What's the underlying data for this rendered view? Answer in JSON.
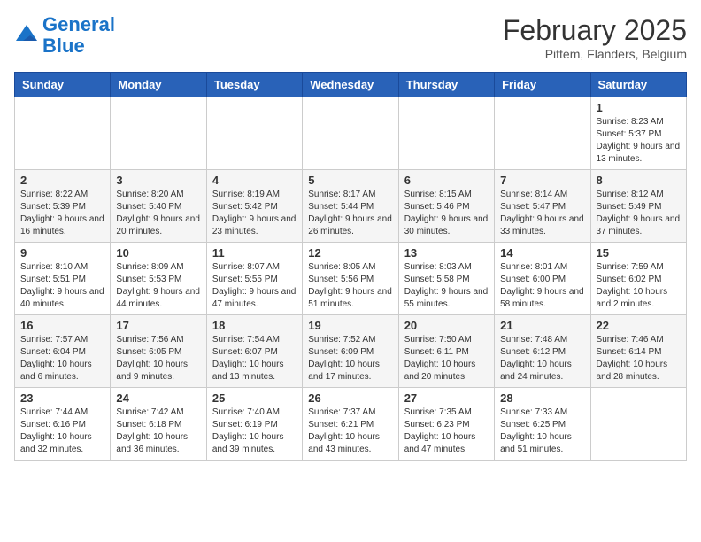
{
  "header": {
    "logo_line1": "General",
    "logo_line2": "Blue",
    "month_title": "February 2025",
    "location": "Pittem, Flanders, Belgium"
  },
  "days_of_week": [
    "Sunday",
    "Monday",
    "Tuesday",
    "Wednesday",
    "Thursday",
    "Friday",
    "Saturday"
  ],
  "weeks": [
    [
      {
        "num": "",
        "info": ""
      },
      {
        "num": "",
        "info": ""
      },
      {
        "num": "",
        "info": ""
      },
      {
        "num": "",
        "info": ""
      },
      {
        "num": "",
        "info": ""
      },
      {
        "num": "",
        "info": ""
      },
      {
        "num": "1",
        "info": "Sunrise: 8:23 AM\nSunset: 5:37 PM\nDaylight: 9 hours and 13 minutes."
      }
    ],
    [
      {
        "num": "2",
        "info": "Sunrise: 8:22 AM\nSunset: 5:39 PM\nDaylight: 9 hours and 16 minutes."
      },
      {
        "num": "3",
        "info": "Sunrise: 8:20 AM\nSunset: 5:40 PM\nDaylight: 9 hours and 20 minutes."
      },
      {
        "num": "4",
        "info": "Sunrise: 8:19 AM\nSunset: 5:42 PM\nDaylight: 9 hours and 23 minutes."
      },
      {
        "num": "5",
        "info": "Sunrise: 8:17 AM\nSunset: 5:44 PM\nDaylight: 9 hours and 26 minutes."
      },
      {
        "num": "6",
        "info": "Sunrise: 8:15 AM\nSunset: 5:46 PM\nDaylight: 9 hours and 30 minutes."
      },
      {
        "num": "7",
        "info": "Sunrise: 8:14 AM\nSunset: 5:47 PM\nDaylight: 9 hours and 33 minutes."
      },
      {
        "num": "8",
        "info": "Sunrise: 8:12 AM\nSunset: 5:49 PM\nDaylight: 9 hours and 37 minutes."
      }
    ],
    [
      {
        "num": "9",
        "info": "Sunrise: 8:10 AM\nSunset: 5:51 PM\nDaylight: 9 hours and 40 minutes."
      },
      {
        "num": "10",
        "info": "Sunrise: 8:09 AM\nSunset: 5:53 PM\nDaylight: 9 hours and 44 minutes."
      },
      {
        "num": "11",
        "info": "Sunrise: 8:07 AM\nSunset: 5:55 PM\nDaylight: 9 hours and 47 minutes."
      },
      {
        "num": "12",
        "info": "Sunrise: 8:05 AM\nSunset: 5:56 PM\nDaylight: 9 hours and 51 minutes."
      },
      {
        "num": "13",
        "info": "Sunrise: 8:03 AM\nSunset: 5:58 PM\nDaylight: 9 hours and 55 minutes."
      },
      {
        "num": "14",
        "info": "Sunrise: 8:01 AM\nSunset: 6:00 PM\nDaylight: 9 hours and 58 minutes."
      },
      {
        "num": "15",
        "info": "Sunrise: 7:59 AM\nSunset: 6:02 PM\nDaylight: 10 hours and 2 minutes."
      }
    ],
    [
      {
        "num": "16",
        "info": "Sunrise: 7:57 AM\nSunset: 6:04 PM\nDaylight: 10 hours and 6 minutes."
      },
      {
        "num": "17",
        "info": "Sunrise: 7:56 AM\nSunset: 6:05 PM\nDaylight: 10 hours and 9 minutes."
      },
      {
        "num": "18",
        "info": "Sunrise: 7:54 AM\nSunset: 6:07 PM\nDaylight: 10 hours and 13 minutes."
      },
      {
        "num": "19",
        "info": "Sunrise: 7:52 AM\nSunset: 6:09 PM\nDaylight: 10 hours and 17 minutes."
      },
      {
        "num": "20",
        "info": "Sunrise: 7:50 AM\nSunset: 6:11 PM\nDaylight: 10 hours and 20 minutes."
      },
      {
        "num": "21",
        "info": "Sunrise: 7:48 AM\nSunset: 6:12 PM\nDaylight: 10 hours and 24 minutes."
      },
      {
        "num": "22",
        "info": "Sunrise: 7:46 AM\nSunset: 6:14 PM\nDaylight: 10 hours and 28 minutes."
      }
    ],
    [
      {
        "num": "23",
        "info": "Sunrise: 7:44 AM\nSunset: 6:16 PM\nDaylight: 10 hours and 32 minutes."
      },
      {
        "num": "24",
        "info": "Sunrise: 7:42 AM\nSunset: 6:18 PM\nDaylight: 10 hours and 36 minutes."
      },
      {
        "num": "25",
        "info": "Sunrise: 7:40 AM\nSunset: 6:19 PM\nDaylight: 10 hours and 39 minutes."
      },
      {
        "num": "26",
        "info": "Sunrise: 7:37 AM\nSunset: 6:21 PM\nDaylight: 10 hours and 43 minutes."
      },
      {
        "num": "27",
        "info": "Sunrise: 7:35 AM\nSunset: 6:23 PM\nDaylight: 10 hours and 47 minutes."
      },
      {
        "num": "28",
        "info": "Sunrise: 7:33 AM\nSunset: 6:25 PM\nDaylight: 10 hours and 51 minutes."
      },
      {
        "num": "",
        "info": ""
      }
    ]
  ]
}
